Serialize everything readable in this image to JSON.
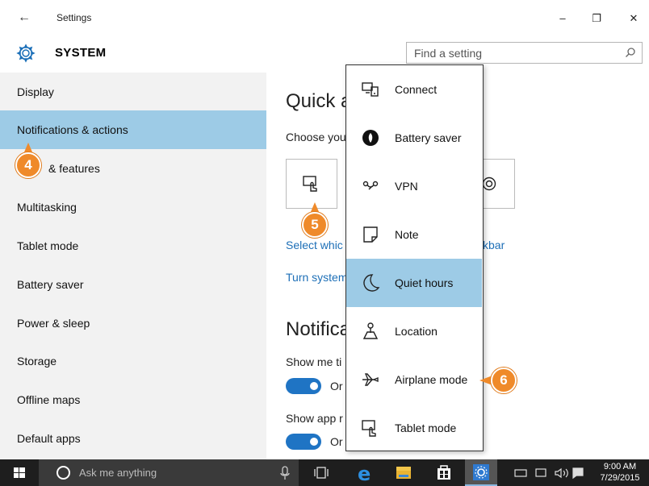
{
  "titlebar": {
    "title": "Settings",
    "back_glyph": "←",
    "minimize_glyph": "–",
    "maximize_glyph": "❐",
    "close_glyph": "✕"
  },
  "header": {
    "section": "SYSTEM",
    "search_placeholder": "Find a setting"
  },
  "sidebar": {
    "items": [
      {
        "label": "Display"
      },
      {
        "label": "Notifications & actions"
      },
      {
        "label": "& features"
      },
      {
        "label": "Multitasking"
      },
      {
        "label": "Tablet mode"
      },
      {
        "label": "Battery saver"
      },
      {
        "label": "Power & sleep"
      },
      {
        "label": "Storage"
      },
      {
        "label": "Offline maps"
      },
      {
        "label": "Default apps"
      }
    ]
  },
  "main": {
    "quick_heading": "Quick a",
    "choose_text": "Choose you",
    "select_link": "Select whic",
    "select_link_tail": "kbar",
    "turn_link": "Turn system",
    "notif_heading": "Notifica",
    "show1": "Show me ti",
    "show2": "Show app r",
    "on1": "Or",
    "on2": "Or"
  },
  "popup": {
    "items": [
      {
        "label": "Connect",
        "icon": "connect-icon"
      },
      {
        "label": "Battery saver",
        "icon": "battery-saver-icon"
      },
      {
        "label": "VPN",
        "icon": "vpn-icon"
      },
      {
        "label": "Note",
        "icon": "note-icon"
      },
      {
        "label": "Quiet hours",
        "icon": "moon-icon"
      },
      {
        "label": "Location",
        "icon": "location-icon"
      },
      {
        "label": "Airplane mode",
        "icon": "airplane-icon"
      },
      {
        "label": "Tablet mode",
        "icon": "tablet-mode-icon"
      }
    ],
    "selected": "Quiet hours"
  },
  "callouts": {
    "b4": "4",
    "b5": "5",
    "b6": "6"
  },
  "taskbar": {
    "search_placeholder": "Ask me anything",
    "time": "9:00 AM",
    "date": "7/29/2015"
  },
  "colors": {
    "accent": "#1f74c4",
    "selected_bg": "#9dcbe6",
    "callout": "#ef8a2a",
    "link": "#1d6fb7",
    "sidebar_bg": "#f2f2f2",
    "taskbar_bg": "#1e1e1e"
  }
}
